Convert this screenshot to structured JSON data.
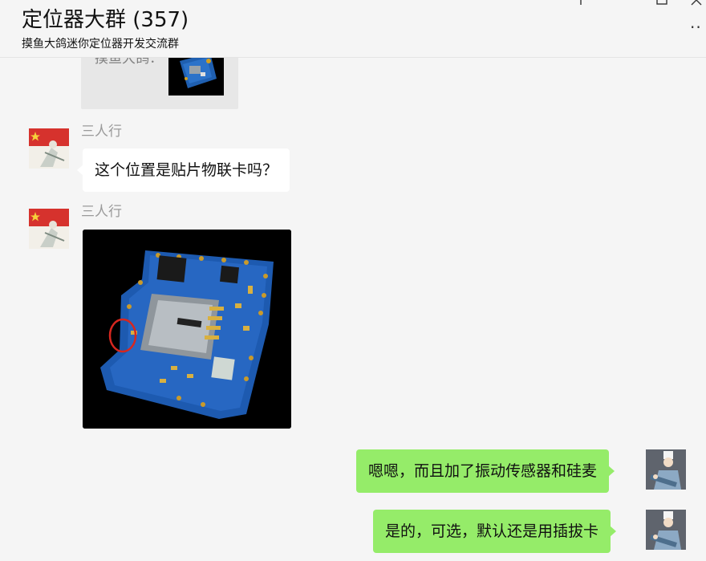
{
  "header": {
    "title": "定位器大群 (357)",
    "subtitle": "摸鱼大鸽迷你定位器开发交流群"
  },
  "chat": {
    "quote": {
      "sender_prefix": "摸鱼大鸽："
    },
    "messages": [
      {
        "sender": "三人行",
        "text": "这个位置是贴片物联卡吗？"
      },
      {
        "sender": "三人行",
        "image": "pcb-photo"
      },
      {
        "sender": "",
        "text": "嗯嗯，而且加了振动传感器和硅麦"
      },
      {
        "sender": "",
        "text": "是的，可选，默认还是用插拔卡"
      }
    ]
  },
  "colors": {
    "background": "#f5f5f5",
    "incoming_bubble": "#ffffff",
    "outgoing_bubble": "#95ec69",
    "sender_name": "#9a9a9a"
  },
  "icons": [
    "pin-icon",
    "maximize-icon",
    "close-icon",
    "more-icon"
  ]
}
